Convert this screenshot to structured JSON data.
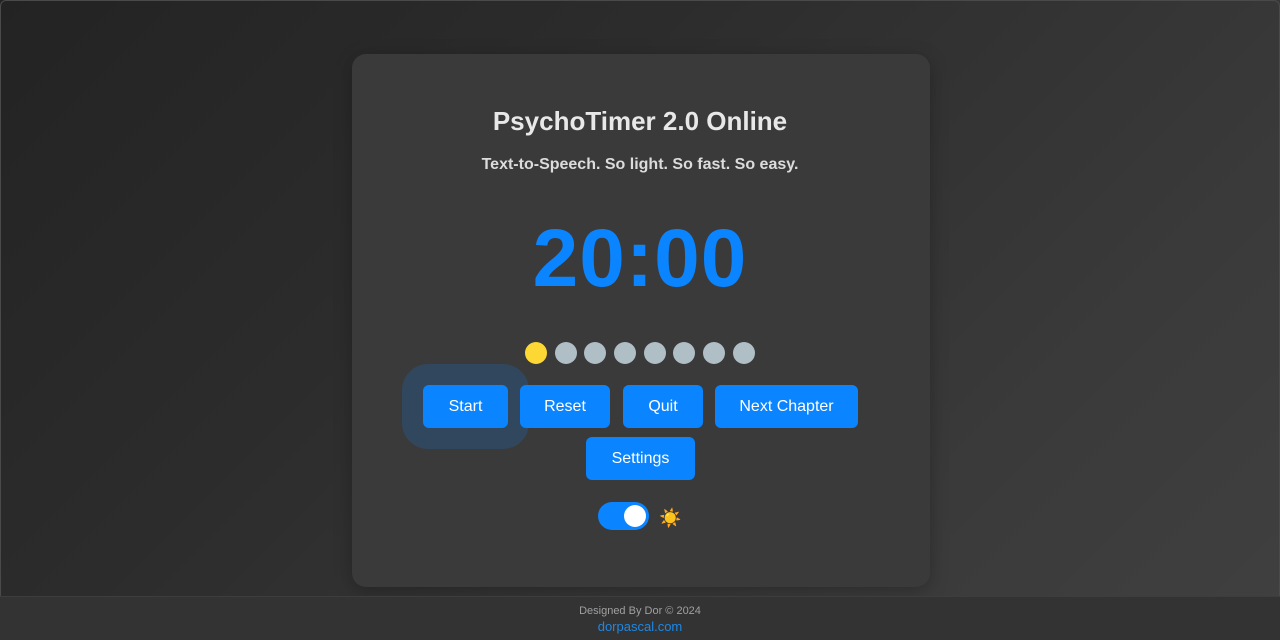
{
  "app": {
    "title": "PsychoTimer 2.0 Online",
    "subtitle": "Text-to-Speech. So light. So fast. So easy."
  },
  "timer": {
    "display": "20:00"
  },
  "chapters": {
    "total": 8,
    "active_index": 0
  },
  "buttons": {
    "start": "Start",
    "reset": "Reset",
    "quit": "Quit",
    "next_chapter": "Next Chapter",
    "settings": "Settings"
  },
  "theme_toggle": {
    "state": "on",
    "icon": "sun-icon",
    "glyph": "☀️"
  },
  "footer": {
    "credit": "Designed By Dor © 2024",
    "link": "dorpascal.com"
  },
  "colors": {
    "accent": "#0a84ff",
    "active_dot": "#fdd835",
    "inactive_dot": "#b0bec5"
  }
}
